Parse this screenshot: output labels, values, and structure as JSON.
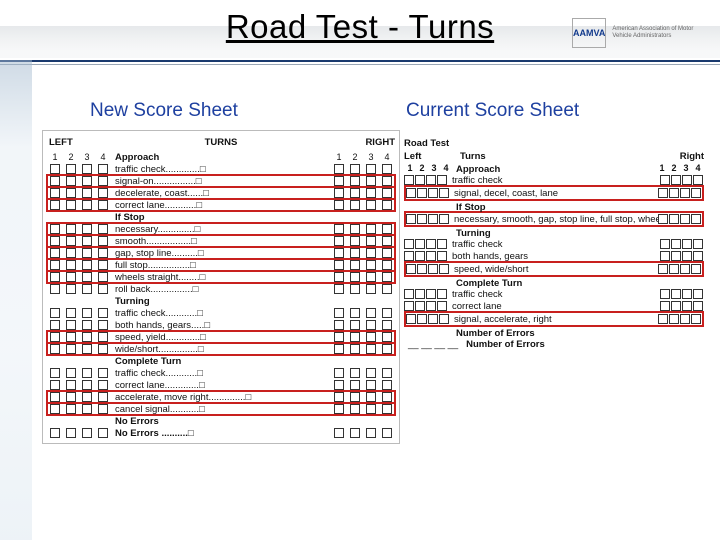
{
  "title": "Road Test - Turns",
  "logo": {
    "mark": "AAMVA",
    "text": "American Association of\nMotor Vehicle Administrators"
  },
  "left": {
    "heading": "New Score Sheet",
    "leftLabel": "LEFT",
    "centerLabel": "TURNS",
    "rightLabel": "RIGHT",
    "cols": [
      "1",
      "2",
      "3",
      "4"
    ],
    "sections": [
      {
        "title": "Approach",
        "items": [
          {
            "t": "traffic check.............",
            "hl": false
          },
          {
            "t": "signal-on................",
            "hl": true
          },
          {
            "t": "decelerate, coast......",
            "hl": true
          },
          {
            "t": "correct lane............",
            "hl": true
          }
        ]
      },
      {
        "title": "If Stop",
        "items": [
          {
            "t": "necessary..............",
            "hl": true
          },
          {
            "t": "smooth.................",
            "hl": true
          },
          {
            "t": "gap, stop line..........",
            "hl": true
          },
          {
            "t": "full stop................",
            "hl": true
          },
          {
            "t": "wheels straight........",
            "hl": true
          },
          {
            "t": "roll back................",
            "hl": false
          }
        ]
      },
      {
        "title": "Turning",
        "items": [
          {
            "t": "traffic check............",
            "hl": false
          },
          {
            "t": "both hands, gears.....",
            "hl": false
          },
          {
            "t": "speed, yield.............",
            "hl": true
          },
          {
            "t": "wide/short...............",
            "hl": true
          }
        ]
      },
      {
        "title": "Complete Turn",
        "items": [
          {
            "t": "traffic check............",
            "hl": false
          },
          {
            "t": "correct lane.............",
            "hl": false
          },
          {
            "t": "accelerate, move right..............",
            "hl": true
          },
          {
            "t": "cancel signal...........",
            "hl": true
          }
        ]
      },
      {
        "title": "No Errors",
        "items": [],
        "tail": true
      }
    ]
  },
  "right": {
    "heading": "Current Score Sheet",
    "roadTest": "Road Test",
    "leftLabel": "Left",
    "centerLabel": "Turns",
    "rightLabel": "Right",
    "cols": [
      "1",
      "2",
      "3",
      "4"
    ],
    "sections": [
      {
        "title": "Approach",
        "items": [
          {
            "t": "traffic check",
            "hl": false
          },
          {
            "t": "signal, decel, coast, lane",
            "hl": true
          }
        ]
      },
      {
        "title": "If Stop",
        "items": [
          {
            "t": "necessary, smooth, gap, stop line, full stop, wheels straight",
            "hl": true
          }
        ]
      },
      {
        "title": "Turning",
        "items": [
          {
            "t": "traffic check",
            "hl": false
          },
          {
            "t": "both hands, gears",
            "hl": false
          },
          {
            "t": "speed, wide/short",
            "hl": true
          }
        ]
      },
      {
        "title": "Complete Turn",
        "items": [
          {
            "t": "traffic check",
            "hl": false
          },
          {
            "t": "correct lane",
            "hl": false
          },
          {
            "t": "signal, accelerate, right",
            "hl": true
          }
        ]
      },
      {
        "title": "Number of Errors",
        "items": [],
        "dash": true
      }
    ]
  }
}
